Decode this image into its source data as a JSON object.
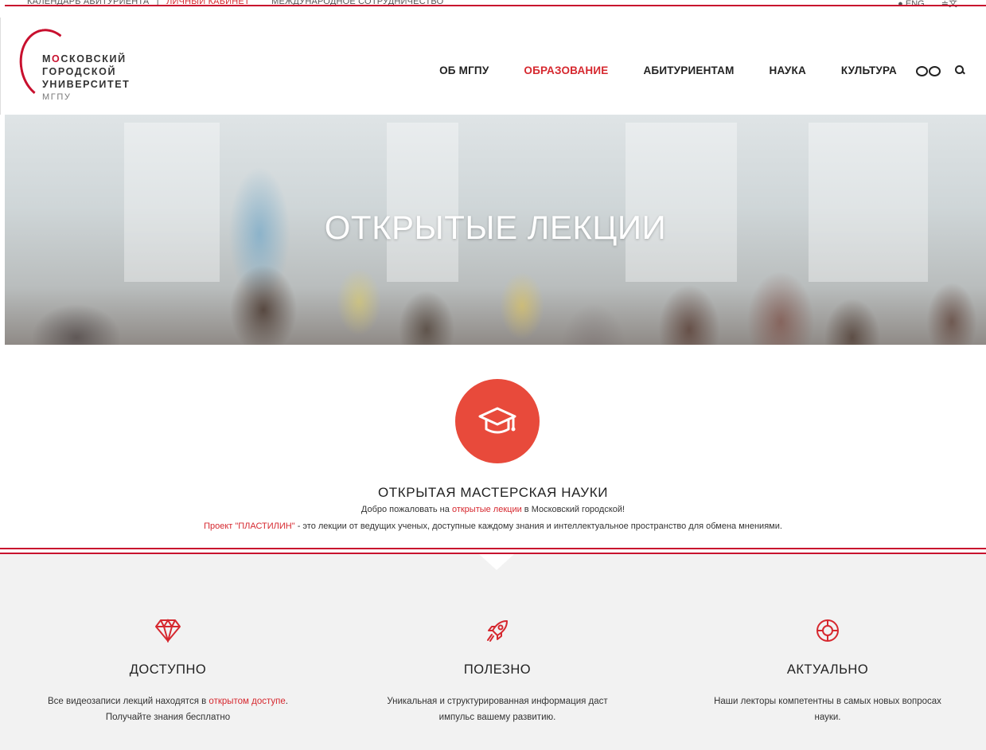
{
  "topbar": {
    "link1": "КАЛЕНДАРЬ АБИТУРИЕНТА",
    "separator": "|",
    "link2": "ЛИЧНЫЙ КАБИНЕТ",
    "link3": "МЕЖДУНАРОДНОЕ СОТРУДНИЧЕСТВО",
    "lang": "ENG",
    "accessibility": "≑文"
  },
  "logo": {
    "line1_first": "М",
    "line1_o": "О",
    "line1_rest": "СКОВСКИЙ",
    "line2": "ГОРОДСКОЙ",
    "line3": "УНИВЕРСИТЕТ",
    "line4": "МГПУ"
  },
  "nav": {
    "items": [
      "ОБ МГПУ",
      "ОБРАЗОВАНИЕ",
      "АБИТУРИЕНТАМ",
      "НАУКА",
      "КУЛЬТУРА"
    ],
    "active_index": 1
  },
  "hero": {
    "title": "ОТКРЫТЫЕ ЛЕКЦИИ"
  },
  "intro": {
    "icon": "graduation-cap-icon",
    "heading": "ОТКРЫТАЯ МАСТЕРСКАЯ НАУКИ",
    "line1_pre": "Добро пожаловать на ",
    "line1_link": "открытые лекции",
    "line1_post": " в Московский городской!",
    "line2_link": "Проект \"ПЛАСТИЛИН\"",
    "line2_rest": " - это лекции от ведущих ученых, доступные каждому знания и интеллектуальное пространство для обмена мнениями."
  },
  "features": [
    {
      "icon": "diamond-icon",
      "title": "ДОСТУПНО",
      "desc_pre": "Все видеозаписи лекций находятся в ",
      "desc_link": "открытом доступе",
      "desc_post": ".",
      "desc_line2": "Получайте знания бесплатно"
    },
    {
      "icon": "rocket-icon",
      "title": "ПОЛЕЗНО",
      "desc_line1": "Уникальная и структурированная информация даст",
      "desc_line2": "импульс вашему развитию."
    },
    {
      "icon": "lifebuoy-icon",
      "title": "АКТУАЛЬНО",
      "desc_line1": "Наши лекторы компетентны в самых новых вопросах",
      "desc_line2": "науки."
    }
  ],
  "colors": {
    "accent": "#d6282f",
    "brand_red": "#c8102e",
    "icon_circle": "#e84a3b",
    "features_bg": "#f2f2f2"
  }
}
